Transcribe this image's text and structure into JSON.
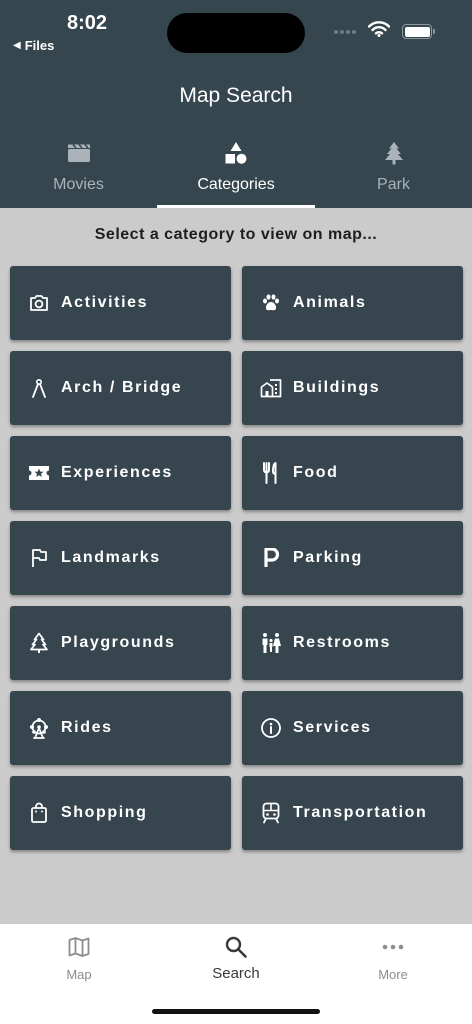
{
  "status": {
    "time": "8:02",
    "back_label": "Files"
  },
  "header": {
    "title": "Map Search"
  },
  "tabs": [
    {
      "label": "Movies",
      "icon": "clapperboard-icon",
      "active": false
    },
    {
      "label": "Categories",
      "icon": "shapes-icon",
      "active": true
    },
    {
      "label": "Park",
      "icon": "tree-icon",
      "active": false
    }
  ],
  "prompt": "Select a category to view on map...",
  "categories": [
    {
      "label": "Activities",
      "icon": "camera-icon"
    },
    {
      "label": "Animals",
      "icon": "paw-icon"
    },
    {
      "label": "Arch / Bridge",
      "icon": "compass-icon"
    },
    {
      "label": "Buildings",
      "icon": "buildings-icon"
    },
    {
      "label": "Experiences",
      "icon": "ticket-star-icon"
    },
    {
      "label": "Food",
      "icon": "fork-knife-icon"
    },
    {
      "label": "Landmarks",
      "icon": "flag-icon"
    },
    {
      "label": "Parking",
      "icon": "parking-icon"
    },
    {
      "label": "Playgrounds",
      "icon": "tree-outline-icon"
    },
    {
      "label": "Restrooms",
      "icon": "family-restroom-icon"
    },
    {
      "label": "Rides",
      "icon": "ferris-wheel-icon"
    },
    {
      "label": "Services",
      "icon": "info-icon"
    },
    {
      "label": "Shopping",
      "icon": "shopping-bag-icon"
    },
    {
      "label": "Transportation",
      "icon": "train-icon"
    }
  ],
  "bottom_nav": [
    {
      "label": "Map",
      "icon": "map-icon",
      "active": false
    },
    {
      "label": "Search",
      "icon": "search-icon",
      "active": true
    },
    {
      "label": "More",
      "icon": "more-dots-icon",
      "active": false
    }
  ],
  "colors": {
    "header_bg": "#36464e",
    "tile_bg": "#36454e",
    "page_bg": "#cbcbcb",
    "tab_inactive": "#a9b3b8"
  }
}
